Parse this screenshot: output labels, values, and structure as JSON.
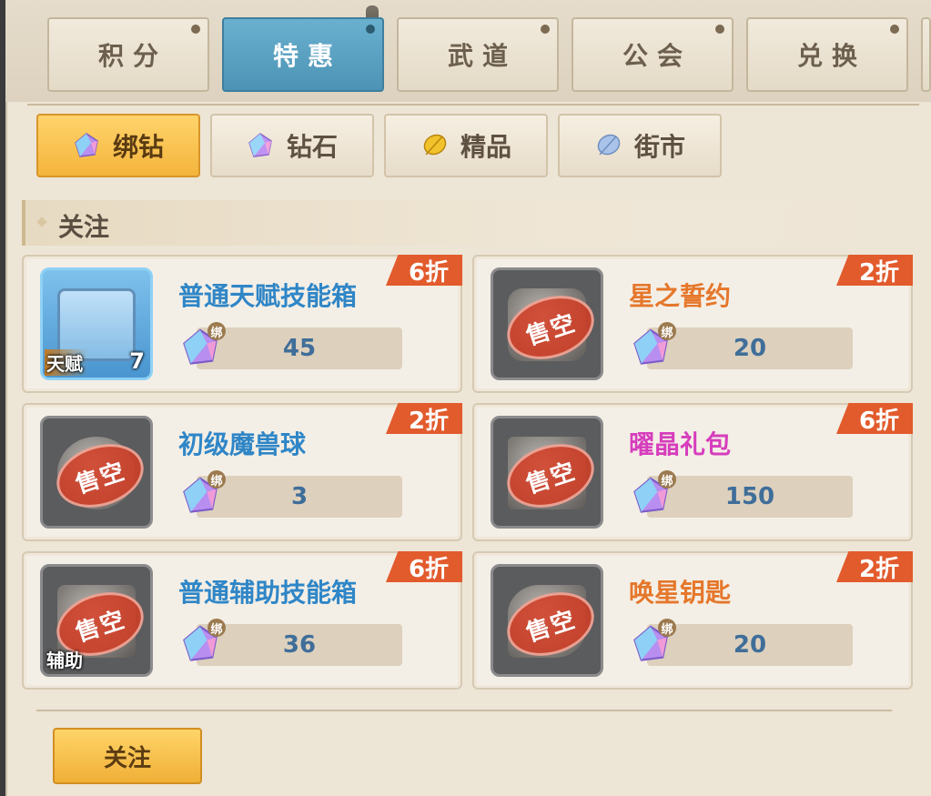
{
  "main_tabs": [
    {
      "label": "积分",
      "active": false
    },
    {
      "label": "特惠",
      "active": true
    },
    {
      "label": "武道",
      "active": false
    },
    {
      "label": "公会",
      "active": false
    },
    {
      "label": "兑换",
      "active": false
    }
  ],
  "sub_tabs": [
    {
      "label": "绑钻",
      "icon": "bound-diamond-icon",
      "active": true
    },
    {
      "label": "钻石",
      "icon": "diamond-icon",
      "active": false
    },
    {
      "label": "精品",
      "icon": "gold-leaf-icon",
      "active": false
    },
    {
      "label": "街市",
      "icon": "blue-leaf-icon",
      "active": false
    }
  ],
  "section_title": "关注",
  "bind_mark": "绑",
  "items": [
    {
      "name": "普通天赋技能箱",
      "name_color": "#2f86c7",
      "price": "45",
      "discount": "6折",
      "sold_out": false,
      "corner_label": "天赋",
      "quantity": "7",
      "icon": "talent-skill-box-icon"
    },
    {
      "name": "星之誓约",
      "name_color": "#e5772b",
      "price": "20",
      "discount": "2折",
      "sold_out": true,
      "sold_out_label": "售空",
      "icon": "star-oath-icon"
    },
    {
      "name": "初级魔兽球",
      "name_color": "#2f86c7",
      "price": "3",
      "discount": "2折",
      "sold_out": true,
      "sold_out_label": "售空",
      "icon": "beast-ball-icon"
    },
    {
      "name": "曜晶礼包",
      "name_color": "#d63ebd",
      "price": "150",
      "discount": "6折",
      "sold_out": true,
      "sold_out_label": "售空",
      "icon": "crystal-gift-pack-icon"
    },
    {
      "name": "普通辅助技能箱",
      "name_color": "#2f86c7",
      "price": "36",
      "discount": "6折",
      "sold_out": true,
      "sold_out_label": "售空",
      "corner_label": "辅助",
      "icon": "support-skill-box-icon"
    },
    {
      "name": "唤星钥匙",
      "name_color": "#e5772b",
      "price": "20",
      "discount": "2折",
      "sold_out": true,
      "sold_out_label": "售空",
      "icon": "star-key-icon"
    }
  ],
  "follow_button": "关注",
  "colors": {
    "active_tab": "#4c93b5",
    "active_subtab": "#f4b43c",
    "discount_badge": "#e25b2d",
    "price_text": "#3f6e99"
  }
}
